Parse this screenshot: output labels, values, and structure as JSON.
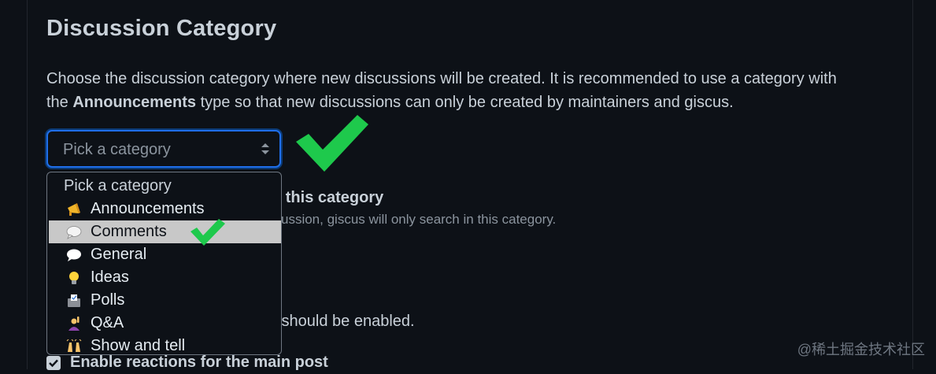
{
  "section": {
    "title": "Discussion Category",
    "description_part1": "Choose the discussion category where new discussions will be created. It is recommended to use a category with",
    "description_part2_prefix": "the ",
    "description_part2_bold": "Announcements",
    "description_part2_suffix": " type so that new discussions can only be created by maintainers and giscus."
  },
  "select": {
    "value": "Pick a category"
  },
  "dropdown": {
    "options": [
      {
        "label": "Pick a category",
        "icon": "none"
      },
      {
        "label": "Announcements",
        "icon": "megaphone-icon"
      },
      {
        "label": "Comments",
        "icon": "speech-bubble-icon",
        "selected": true
      },
      {
        "label": "General",
        "icon": "speech-bubble-icon"
      },
      {
        "label": "Ideas",
        "icon": "lightbulb-icon"
      },
      {
        "label": "Polls",
        "icon": "ballot-box-icon"
      },
      {
        "label": "Q&A",
        "icon": "person-raising-hand-icon"
      },
      {
        "label": "Show and tell",
        "icon": "raising-hands-icon"
      }
    ]
  },
  "background": {
    "strong_fragment": "n this category",
    "sub_fragment": "scussion, giscus will only search in this category.",
    "line3_fragment": "s should be enabled.",
    "reactions_label": "Enable reactions for the main post"
  },
  "watermark": "@稀土掘金技术社区",
  "colors": {
    "background": "#0d1117",
    "accent": "#1f6feb",
    "check_green": "#1ec94c",
    "selected_bg": "#c8c8c8"
  }
}
